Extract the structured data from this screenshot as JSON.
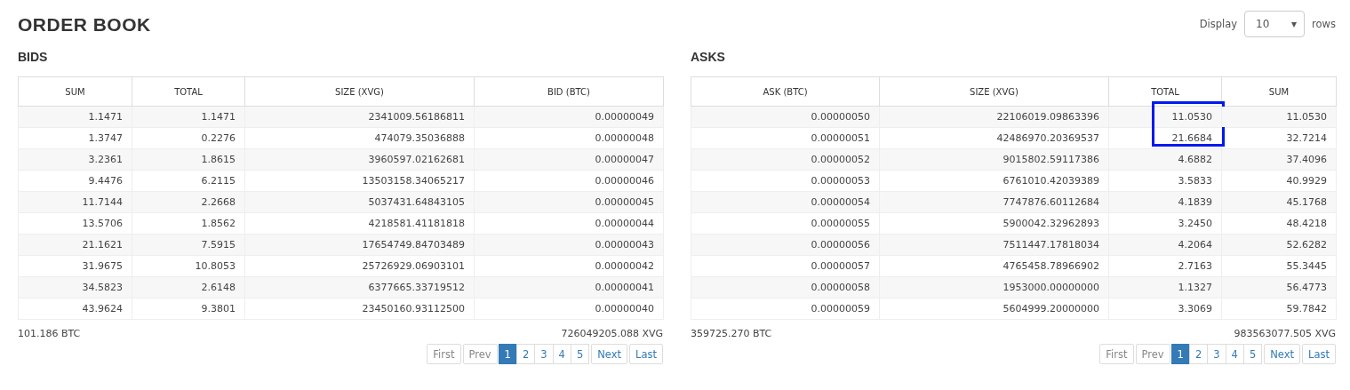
{
  "title": "ORDER BOOK",
  "display": {
    "label": "Display",
    "value": "10",
    "arrow": "▾",
    "suffix": "rows"
  },
  "books": [
    {
      "heading": "BIDS",
      "columns": [
        "SUM",
        "TOTAL",
        "SIZE (XVG)",
        "BID (BTC)"
      ],
      "rows": [
        {
          "cells": [
            "1.1471",
            "1.1471",
            "2341009.56186811",
            "0.00000049"
          ],
          "marked": false
        },
        {
          "cells": [
            "1.3747",
            "0.2276",
            "474079.35036888",
            "0.00000048"
          ],
          "marked": false
        },
        {
          "cells": [
            "3.2361",
            "1.8615",
            "3960597.02162681",
            "0.00000047"
          ],
          "marked": false
        },
        {
          "cells": [
            "9.4476",
            "6.2115",
            "13503158.34065217",
            "0.00000046"
          ],
          "marked": false
        },
        {
          "cells": [
            "11.7144",
            "2.2668",
            "5037431.64843105",
            "0.00000045"
          ],
          "marked": false
        },
        {
          "cells": [
            "13.5706",
            "1.8562",
            "4218581.41181818",
            "0.00000044"
          ],
          "marked": false
        },
        {
          "cells": [
            "21.1621",
            "7.5915",
            "17654749.84703489",
            "0.00000043"
          ],
          "marked": false
        },
        {
          "cells": [
            "31.9675",
            "10.8053",
            "25726929.06903101",
            "0.00000042"
          ],
          "marked": false
        },
        {
          "cells": [
            "34.5823",
            "2.6148",
            "6377665.33719512",
            "0.00000041"
          ],
          "marked": false
        },
        {
          "cells": [
            "43.9624",
            "9.3801",
            "23450160.93112500",
            "0.00000040"
          ],
          "marked": false
        }
      ],
      "footer_left": "101.186 BTC",
      "footer_right": "726049205.088 XVG",
      "pages": [
        {
          "label": "First",
          "selected": false,
          "disabled": true
        },
        {
          "label": "Prev",
          "selected": false,
          "disabled": true
        },
        {
          "label": "1",
          "selected": true,
          "disabled": false
        },
        {
          "label": "2",
          "selected": false,
          "disabled": false
        },
        {
          "label": "3",
          "selected": false,
          "disabled": false
        },
        {
          "label": "4",
          "selected": false,
          "disabled": false
        },
        {
          "label": "5",
          "selected": false,
          "disabled": false
        },
        {
          "label": "Next",
          "selected": false,
          "disabled": false
        },
        {
          "label": "Last",
          "selected": false,
          "disabled": false
        }
      ]
    },
    {
      "heading": "ASKS",
      "columns": [
        "ASK (BTC)",
        "SIZE (XVG)",
        "TOTAL",
        "SUM"
      ],
      "rows": [
        {
          "cells": [
            "0.00000050",
            "22106019.09863396",
            "11.0530",
            "11.0530"
          ],
          "marked": true
        },
        {
          "cells": [
            "0.00000051",
            "42486970.20369537",
            "21.6684",
            "32.7214"
          ],
          "marked": true
        },
        {
          "cells": [
            "0.00000052",
            "9015802.59117386",
            "4.6882",
            "37.4096"
          ],
          "marked": false
        },
        {
          "cells": [
            "0.00000053",
            "6761010.42039389",
            "3.5833",
            "40.9929"
          ],
          "marked": false
        },
        {
          "cells": [
            "0.00000054",
            "7747876.60112684",
            "4.1839",
            "45.1768"
          ],
          "marked": false
        },
        {
          "cells": [
            "0.00000055",
            "5900042.32962893",
            "3.2450",
            "48.4218"
          ],
          "marked": false
        },
        {
          "cells": [
            "0.00000056",
            "7511447.17818034",
            "4.2064",
            "52.6282"
          ],
          "marked": false
        },
        {
          "cells": [
            "0.00000057",
            "4765458.78966902",
            "2.7163",
            "55.3445"
          ],
          "marked": false
        },
        {
          "cells": [
            "0.00000058",
            "1953000.00000000",
            "1.1327",
            "56.4773"
          ],
          "marked": false
        },
        {
          "cells": [
            "0.00000059",
            "5604999.20000000",
            "3.3069",
            "59.7842"
          ],
          "marked": false
        }
      ],
      "footer_left": "359725.270 BTC",
      "footer_right": "983563077.505 XVG",
      "pages": [
        {
          "label": "First",
          "selected": false,
          "disabled": true
        },
        {
          "label": "Prev",
          "selected": false,
          "disabled": true
        },
        {
          "label": "1",
          "selected": true,
          "disabled": false
        },
        {
          "label": "2",
          "selected": false,
          "disabled": false
        },
        {
          "label": "3",
          "selected": false,
          "disabled": false
        },
        {
          "label": "4",
          "selected": false,
          "disabled": false
        },
        {
          "label": "5",
          "selected": false,
          "disabled": false
        },
        {
          "label": "Next",
          "selected": false,
          "disabled": false
        },
        {
          "label": "Last",
          "selected": false,
          "disabled": false
        }
      ]
    }
  ]
}
